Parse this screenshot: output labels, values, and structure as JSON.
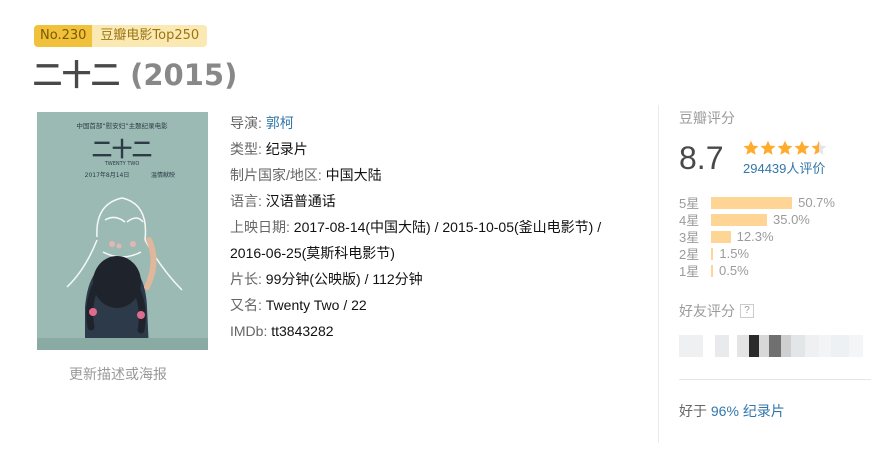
{
  "rank": {
    "no": "No.230",
    "list": "豆瓣电影Top250"
  },
  "title": {
    "name": "二十二",
    "year": "(2015)"
  },
  "poster": {
    "top_text": "中国首部“慰安妇”主题纪录电影",
    "title": "二十二",
    "subtitle": "TWENTY TWO",
    "date": "2017年8月14日",
    "slogan": "温情献映"
  },
  "update_link": "更新描述或海报",
  "info": {
    "director_label": "导演:",
    "director": "郭柯",
    "genre_label": "类型:",
    "genre": "纪录片",
    "country_label": "制片国家/地区:",
    "country": "中国大陆",
    "language_label": "语言:",
    "language": "汉语普通话",
    "release_label": "上映日期:",
    "release_1": "2017-08-14(中国大陆)",
    "release_sep1": " / ",
    "release_2": "2015-10-05(釜山电影节)",
    "release_sep2": " / ",
    "release_3": "2016-06-25(莫斯科电影节)",
    "runtime_label": "片长:",
    "runtime_1": "99分钟(公映版)",
    "runtime_sep": " / ",
    "runtime_2": "112分钟",
    "aka_label": "又名:",
    "aka": "Twenty Two / 22",
    "imdb_label": "IMDb:",
    "imdb": "tt3843282"
  },
  "rating": {
    "title": "豆瓣评分",
    "score": "8.7",
    "stars": 4.5,
    "votes": "294439人评价",
    "star_color": "#ffac2d",
    "distribution": [
      {
        "label": "5星",
        "percent": "50.7%",
        "value": 50.7
      },
      {
        "label": "4星",
        "percent": "35.0%",
        "value": 35.0
      },
      {
        "label": "3星",
        "percent": "12.3%",
        "value": 12.3
      },
      {
        "label": "2星",
        "percent": "1.5%",
        "value": 1.5
      },
      {
        "label": "1星",
        "percent": "0.5%",
        "value": 0.5
      }
    ],
    "friend_title": "好友评分",
    "help_icon": "?",
    "better_prefix": "好于",
    "better_percent": "96%",
    "better_genre": "纪录片"
  }
}
